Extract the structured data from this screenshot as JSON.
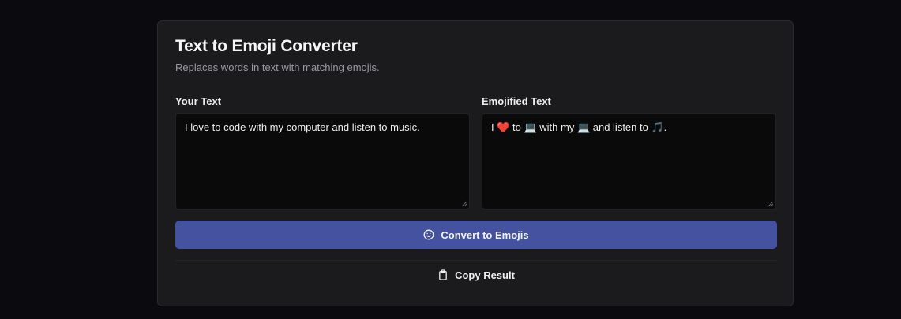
{
  "header": {
    "title": "Text to Emoji Converter",
    "subtitle": "Replaces words in text with matching emojis."
  },
  "input": {
    "label": "Your Text",
    "value": "I love to code with my computer and listen to music."
  },
  "output": {
    "label": "Emojified Text",
    "value": "I ❤️ to 💻 with my 💻 and listen to 🎵."
  },
  "actions": {
    "convert_label": "Convert to Emojis",
    "convert_icon": "smile-icon",
    "copy_label": "Copy Result",
    "copy_icon": "clipboard-icon"
  },
  "colors": {
    "background": "#0b0b0f",
    "card": "#1b1b1d",
    "accent": "#4552a0",
    "textarea": "#0a0a0b"
  }
}
